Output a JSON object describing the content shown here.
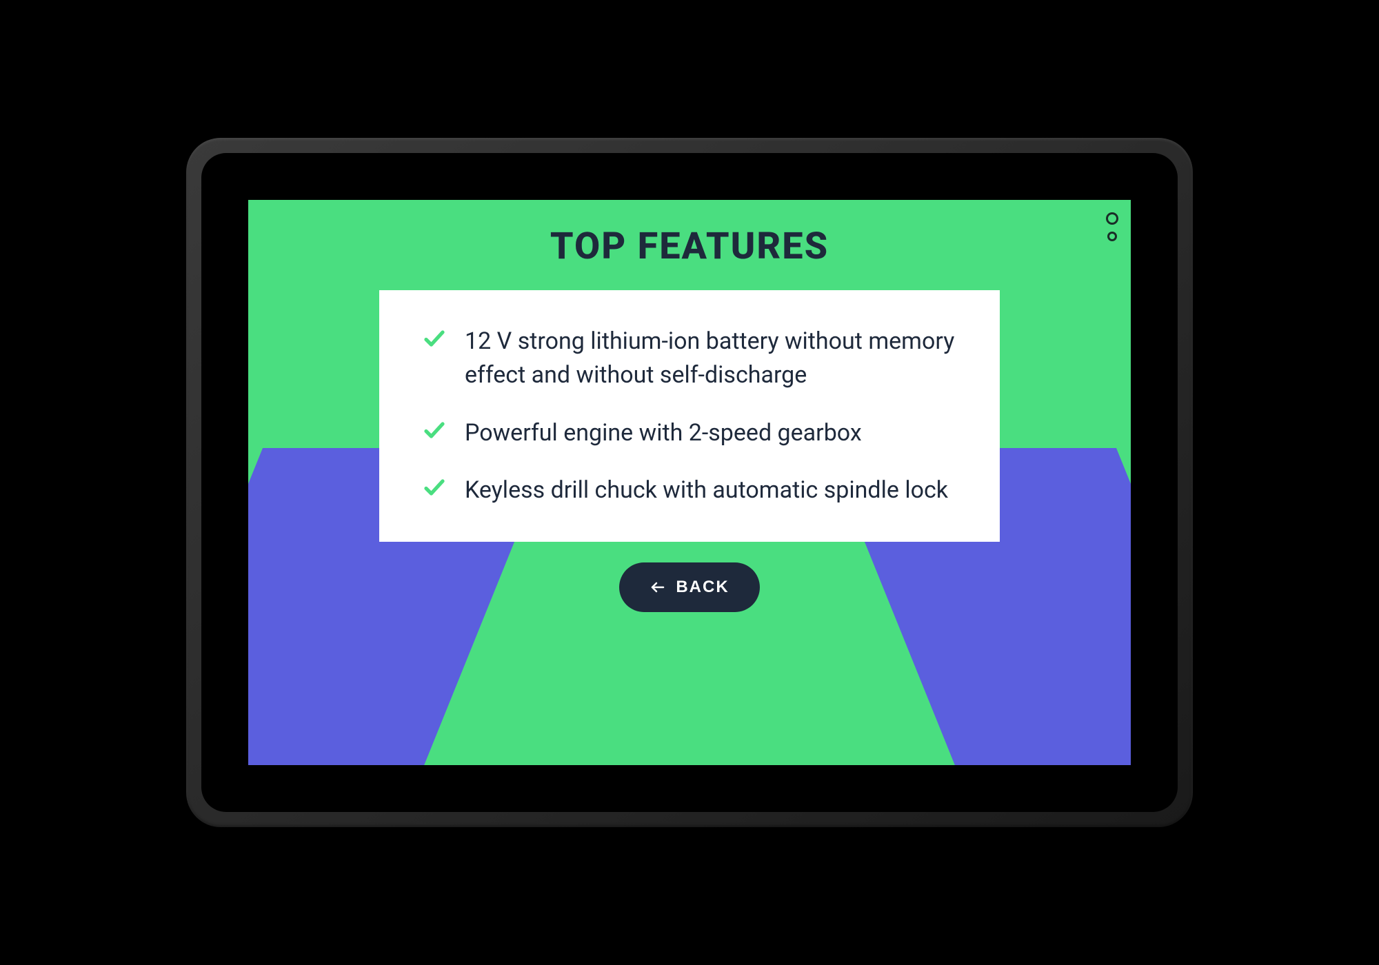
{
  "header": {
    "title": "TOP FEATURES"
  },
  "features": {
    "items": [
      "12 V strong lithium-ion battery without memory effect and without self-discharge",
      "Powerful engine with 2-speed gearbox",
      "Keyless drill chuck with automatic spindle lock"
    ]
  },
  "actions": {
    "back_label": "BACK"
  },
  "colors": {
    "primary_green": "#4ADE80",
    "accent_blue": "#5B5FDE",
    "dark": "#1E293B",
    "white": "#FFFFFF"
  }
}
